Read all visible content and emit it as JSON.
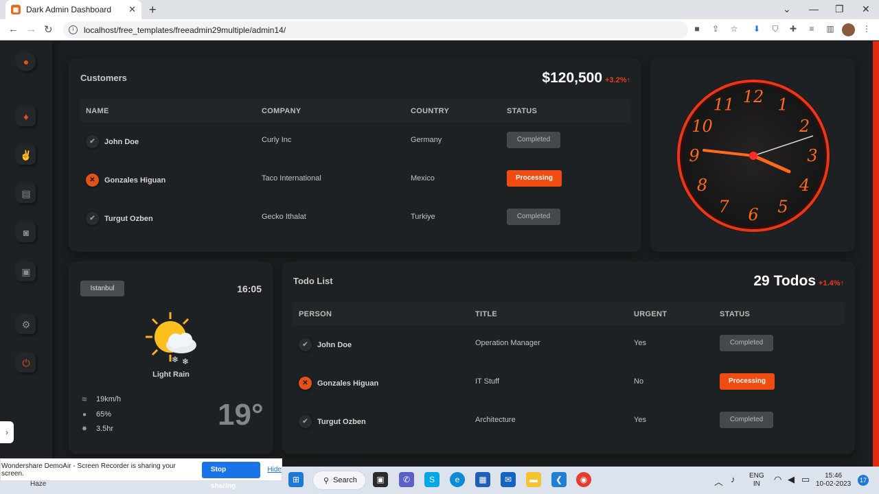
{
  "browser": {
    "tab_title": "Dark Admin Dashboard",
    "tab_close": "✕",
    "new_tab": "+",
    "url": "localhost/free_templates/freeadmin29multiple/admin14/",
    "window_min": "—",
    "window_max": "❐",
    "window_close": "✕",
    "down": "⌄"
  },
  "customers": {
    "title": "Customers",
    "total": "$120,500",
    "change": "+3.2%",
    "headers": [
      "NAME",
      "COMPANY",
      "COUNTRY",
      "STATUS"
    ],
    "rows": [
      {
        "name": "John Doe",
        "company": "Curly Inc",
        "country": "Germany",
        "status": "Completed"
      },
      {
        "name": "Gonzales Higuan",
        "company": "Taco International",
        "country": "Mexico",
        "status": "Processing"
      },
      {
        "name": "Turgut Ozben",
        "company": "Gecko Ithalat",
        "country": "Turkiye",
        "status": "Completed"
      }
    ]
  },
  "clock": {
    "numbers": [
      "12",
      "1",
      "2",
      "3",
      "4",
      "5",
      "6",
      "7",
      "8",
      "9",
      "10",
      "11"
    ]
  },
  "weather": {
    "city": "Istanbul",
    "time": "16:05",
    "condition": "Light Rain",
    "wind": "19km/h",
    "humidity": "65%",
    "sun": "3.5hr",
    "temperature": "19°"
  },
  "todos": {
    "title": "Todo List",
    "count": "29 Todos",
    "change": "+1.4%",
    "headers": [
      "PERSON",
      "TITLE",
      "URGENT",
      "STATUS"
    ],
    "rows": [
      {
        "person": "John Doe",
        "title": "Operation Manager",
        "urgent": "Yes",
        "status": "Completed"
      },
      {
        "person": "Gonzales Higuan",
        "title": "IT Stuff",
        "urgent": "No",
        "status": "Processing"
      },
      {
        "person": "Turgut Ozben",
        "title": "Architecture",
        "urgent": "Yes",
        "status": "Completed"
      }
    ]
  },
  "share_bar": {
    "message": "Wondershare DemoAir - Screen Recorder is sharing your screen.",
    "stop": "Stop sharing",
    "hide": "Hide"
  },
  "taskbar": {
    "weather": "Haze",
    "search": "Search",
    "lang1": "ENG",
    "lang2": "IN",
    "time": "15:46",
    "date": "10-02-2023",
    "notifications": "17"
  },
  "colors": {
    "accent": "#ee4c10",
    "background": "#1b1e20",
    "card": "#1e2123"
  }
}
